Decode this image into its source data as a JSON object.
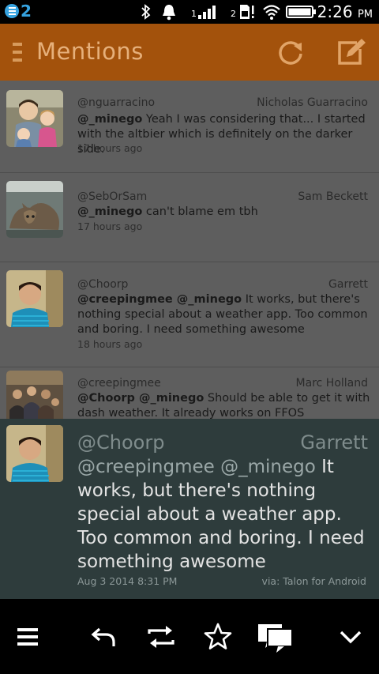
{
  "status_bar": {
    "notification_count": "2",
    "sim1_label": "1",
    "sim2_label": "2",
    "time": "2:26",
    "ampm": "PM",
    "icons": [
      "talon-notification-icon",
      "bluetooth-icon",
      "alarm-icon",
      "signal-icon",
      "sim-icon",
      "wifi-icon",
      "battery-icon"
    ]
  },
  "action_bar": {
    "title": "Mentions",
    "accent_color": "#a3520c",
    "icons": [
      "drawer-icon",
      "refresh-icon",
      "compose-icon"
    ]
  },
  "tweets": [
    {
      "screen_name": "@nguarracino",
      "name": "Nicholas Guarracino",
      "mentions": "@_minego",
      "text": " Yeah I was considering that... I started with the altbier which is definitely on the darker side.",
      "time": "17 hours ago"
    },
    {
      "screen_name": "@SebOrSam",
      "name": "Sam Beckett",
      "mentions": "@_minego",
      "text": " can't blame em tbh",
      "time": "17 hours ago"
    },
    {
      "screen_name": "@Choorp",
      "name": "Garrett",
      "mentions": "@creepingmee @_minego",
      "text": " It works, but there's nothing special about a weather app. Too common and boring. I need something awesome",
      "time": "18 hours ago"
    },
    {
      "screen_name": "@creepingmee",
      "name": "Marc Holland",
      "mentions": "@Choorp @_minego",
      "text": " Should be able to get it with dash weather. It already works on FFOS",
      "time": ""
    }
  ],
  "expanded": {
    "screen_name": "@Choorp",
    "name": "Garrett",
    "mentions": "@creepingmee @_minego",
    "text": " It works, but there's nothing special about a weather app. Too common and boring. I need something awesome",
    "date": "Aug 3 2014 8:31 PM",
    "via": "via: Talon for Android"
  },
  "bottom_bar": {
    "icons": [
      "menu-icon",
      "reply-icon",
      "retweet-icon",
      "favorite-icon",
      "conversation-icon",
      "collapse-icon"
    ]
  }
}
